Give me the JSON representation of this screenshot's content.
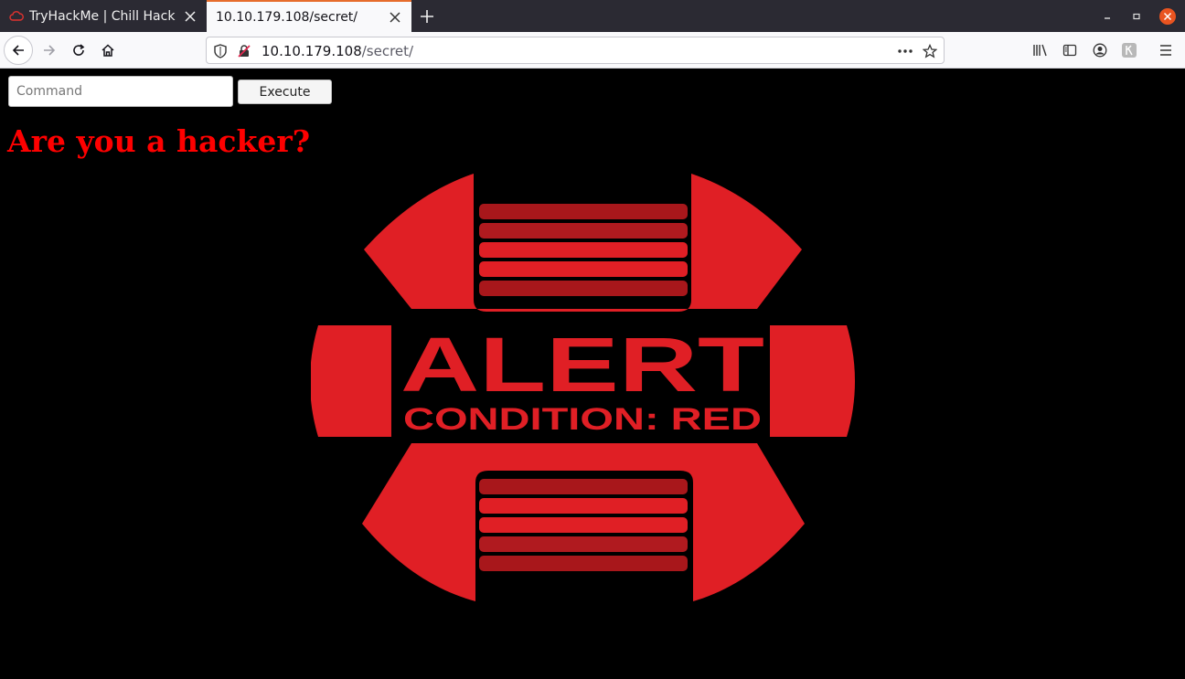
{
  "browser": {
    "tabs": [
      {
        "label": "TryHackMe | Chill Hack",
        "active": false,
        "icon": "cloud-icon"
      },
      {
        "label": "10.10.179.108/secret/",
        "active": true
      }
    ],
    "url": {
      "host": "10.10.179.108",
      "path": "/secret/"
    }
  },
  "page": {
    "command_input": {
      "placeholder": "Command",
      "value": ""
    },
    "execute_label": "Execute",
    "headline": "Are you a hacker?"
  },
  "alert_graphic": {
    "title": "ALERT",
    "subtitle": "CONDITION: RED",
    "color": "#e01f25"
  }
}
